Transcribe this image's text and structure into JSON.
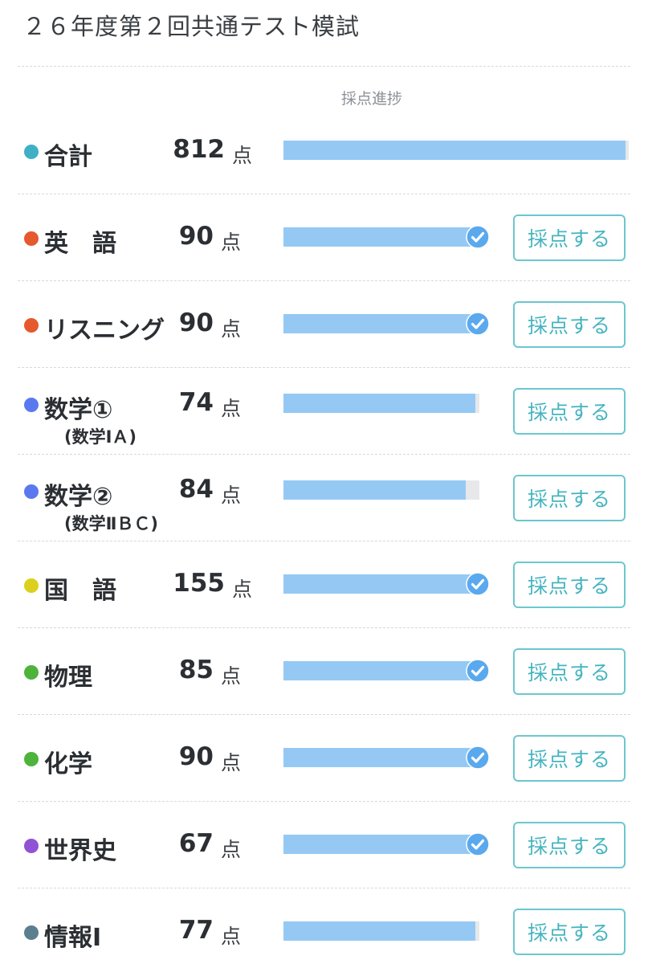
{
  "page_title": "２６年度第２回共通テスト模試",
  "progress_header": "採点進捗",
  "unit_label": "点",
  "grade_button_label": "採点する",
  "colors": {
    "bar_fill": "#95c9f4",
    "bar_track": "#e6e8ea",
    "check": "#5aa9ee",
    "button_border": "#6cc7cf",
    "button_text": "#45b4bf"
  },
  "total": {
    "label": "合計",
    "score": "812",
    "dot_color": "#3fb0c6",
    "progress": 0.99
  },
  "subjects": [
    {
      "label": "英　語",
      "sub": "",
      "score": "90",
      "dot_color": "#e6582e",
      "progress": 1.0,
      "completed": true,
      "icon": "check-circle-icon"
    },
    {
      "label": "リスニング",
      "sub": "",
      "score": "90",
      "dot_color": "#e6582e",
      "progress": 1.0,
      "completed": true,
      "icon": "check-circle-icon"
    },
    {
      "label": "数学①",
      "sub": "(数学ⅠＡ)",
      "score": "74",
      "dot_color": "#5b79ef",
      "progress": 0.98,
      "completed": false,
      "icon": ""
    },
    {
      "label": "数学②",
      "sub": "(数学ⅡＢＣ)",
      "score": "84",
      "dot_color": "#5b79ef",
      "progress": 0.93,
      "completed": false,
      "icon": ""
    },
    {
      "label": "国　語",
      "sub": "",
      "score": "155",
      "dot_color": "#dcd01e",
      "progress": 1.0,
      "completed": true,
      "icon": "check-circle-icon"
    },
    {
      "label": "物理",
      "sub": "",
      "score": "85",
      "dot_color": "#4eb33b",
      "progress": 1.0,
      "completed": true,
      "icon": "check-circle-icon"
    },
    {
      "label": "化学",
      "sub": "",
      "score": "90",
      "dot_color": "#4eb33b",
      "progress": 1.0,
      "completed": true,
      "icon": "check-circle-icon"
    },
    {
      "label": "世界史",
      "sub": "",
      "score": "67",
      "dot_color": "#9152d6",
      "progress": 1.0,
      "completed": true,
      "icon": "check-circle-icon"
    },
    {
      "label": "情報Ⅰ",
      "sub": "",
      "score": "77",
      "dot_color": "#5b7f8f",
      "progress": 0.98,
      "completed": false,
      "icon": ""
    }
  ]
}
